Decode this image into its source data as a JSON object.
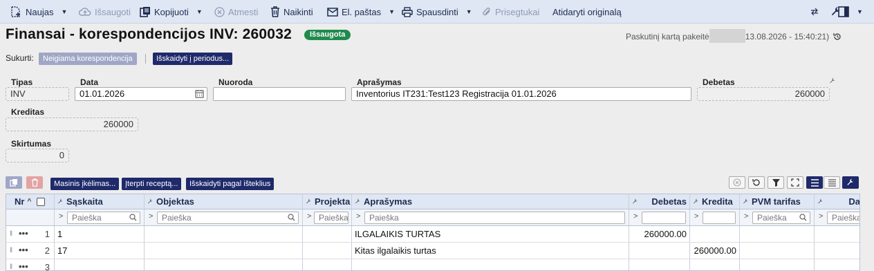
{
  "toolbar": {
    "new_label": "Naujas",
    "save_label": "Išsaugoti",
    "copy_label": "Kopijuoti",
    "cancel_label": "Atmesti",
    "delete_label": "Naikinti",
    "email_label": "El. paštas",
    "print_label": "Spausdinti",
    "attachments_label": "Prisegtukai",
    "open_original_label": "Atidaryti originalą"
  },
  "header": {
    "title": "Finansai - korespondencijos INV: 260032",
    "status_badge": "Išsaugota",
    "last_modified_prefix": "Paskutinį kartą pakeitė",
    "last_modified_time": "13.08.2026 - 15:40:21)",
    "created_label": "Sukurti:",
    "created_button": "Neigiama korespondencija",
    "split_button": "Išskaidyti į periodus..."
  },
  "form": {
    "tipas_label": "Tipas",
    "tipas_value": "INV",
    "data_label": "Data",
    "data_value": "01.01.2026",
    "nuoroda_label": "Nuoroda",
    "nuoroda_value": "",
    "aprasymas_label": "Aprašymas",
    "aprasymas_value": "Inventorius IT231:Test123 Registracija 01.01.2026",
    "debetas_label": "Debetas",
    "debetas_value": "260000",
    "kreditas_label": "Kreditas",
    "kreditas_value": "260000",
    "skirtumas_label": "Skirtumas",
    "skirtumas_value": "0"
  },
  "grid_toolbar": {
    "mass_import": "Masinis įkėlimas...",
    "insert_recipe": "Įterpti receptą...",
    "split_by_resources": "Išskaidyti pagal išteklius"
  },
  "grid": {
    "columns": [
      "Nr",
      "Sąskaita",
      "Objektas",
      "Projekta",
      "Aprašymas",
      "Debetas",
      "Kredita",
      "PVM tarifas",
      "Da"
    ],
    "filter_placeholder": "Paieška",
    "rows": [
      {
        "nr": "1",
        "saskaita": "1",
        "aprasymas": "ILGALAIKIS TURTAS",
        "debetas": "260000.00",
        "kreditas": ""
      },
      {
        "nr": "2",
        "saskaita": "17",
        "aprasymas": "Kitas ilgalaikis turtas",
        "debetas": "",
        "kreditas": "260000.00"
      },
      {
        "nr": "3",
        "saskaita": "",
        "aprasymas": "",
        "debetas": "",
        "kreditas": ""
      }
    ]
  },
  "colors": {
    "navy": "#1f2a6b",
    "badge_green": "#1f8a4c",
    "toolbar_bg": "#dfe7f4"
  }
}
